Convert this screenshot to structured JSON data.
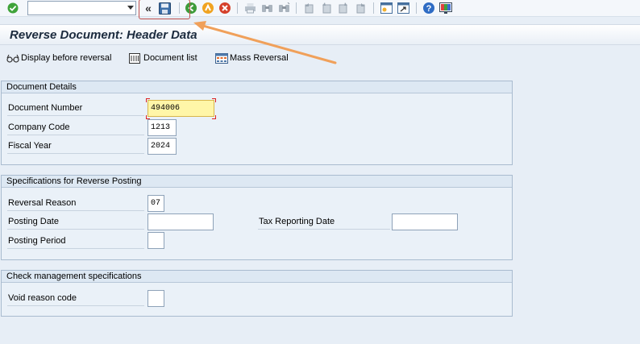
{
  "toolbar": {
    "command_field_value": "",
    "icons": [
      "enter-icon",
      "command-field",
      "back-double-arrow-icon",
      "save-icon",
      "back-icon",
      "exit-icon",
      "cancel-icon",
      "print-icon",
      "find-icon",
      "find-next-icon",
      "first-page-icon",
      "previous-page-icon",
      "next-page-icon",
      "last-page-icon",
      "create-session-icon",
      "generate-shortcut-icon",
      "help-icon",
      "customize-layout-icon"
    ],
    "back_double_arrow": "«"
  },
  "title": "Reverse Document: Header Data",
  "app_toolbar": {
    "display_before_reversal": "Display before reversal",
    "document_list": "Document list",
    "mass_reversal": "Mass Reversal"
  },
  "document_details": {
    "header": "Document Details",
    "document_number_label": "Document Number",
    "document_number_value": "494006",
    "company_code_label": "Company Code",
    "company_code_value": "1213",
    "fiscal_year_label": "Fiscal Year",
    "fiscal_year_value": "2024"
  },
  "reverse_posting": {
    "header": "Specifications for Reverse Posting",
    "reversal_reason_label": "Reversal Reason",
    "reversal_reason_value": "07",
    "posting_date_label": "Posting Date",
    "posting_date_value": "",
    "tax_reporting_date_label": "Tax Reporting Date",
    "tax_reporting_date_value": "",
    "posting_period_label": "Posting Period",
    "posting_period_value": ""
  },
  "check_management": {
    "header": "Check management specifications",
    "void_reason_code_label": "Void reason code",
    "void_reason_code_value": ""
  },
  "colors": {
    "annotation_arrow": "#f0a05a",
    "annotation_box": "#c0504d",
    "required_field": "#fff6a8"
  }
}
